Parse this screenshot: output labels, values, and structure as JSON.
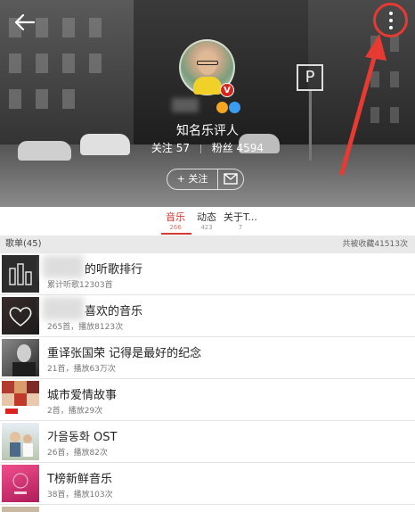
{
  "profile": {
    "nickname": "知名乐评人",
    "follow_label": "关注",
    "follow_count": "57",
    "fans_label": "粉丝",
    "fans_count": "4594",
    "vip_badge": "V",
    "follow_button_label": "+ 关注"
  },
  "tabs": [
    {
      "label": "音乐",
      "count": "266",
      "active": true
    },
    {
      "label": "动态",
      "count": "423",
      "active": false
    },
    {
      "label": "关于T...",
      "count": "7",
      "active": false
    }
  ],
  "section": {
    "title": "歌单(45)",
    "collected": "共被收藏41513次"
  },
  "playlists": [
    {
      "title": "的听歌排行",
      "sub": "累计听歌12303首",
      "thumb": "bars-icon",
      "blurred_prefix": true
    },
    {
      "title": "喜欢的音乐",
      "sub": "265首，播放8123次",
      "thumb": "heart-icon",
      "blurred_prefix": true
    },
    {
      "title": "重译张国荣 记得是最好的纪念",
      "sub": "21首，播放63万次",
      "thumb": "portrait",
      "blurred_prefix": false
    },
    {
      "title": "城市爱情故事",
      "sub": "2首，播放29次",
      "thumb": "collage",
      "blurred_prefix": false
    },
    {
      "title": "가을동화 OST",
      "sub": "26首，播放82次",
      "thumb": "photo",
      "blurred_prefix": false
    },
    {
      "title": "T榜新鲜音乐",
      "sub": "38首，播放103次",
      "thumb": "pink-cover",
      "blurred_prefix": false
    }
  ],
  "icons": {
    "back": "back-arrow-icon",
    "more": "more-vertical-icon",
    "message": "envelope-icon"
  },
  "colors": {
    "accent": "#d33a31",
    "annotation": "#e63a33"
  }
}
